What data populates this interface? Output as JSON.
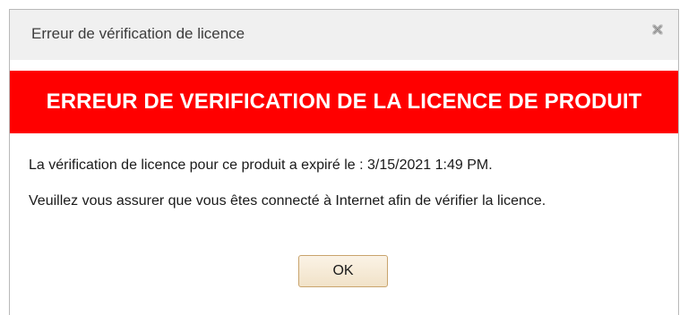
{
  "window": {
    "title": "Erreur de vérification de licence",
    "close_icon": "close-icon"
  },
  "banner": {
    "text": "ERREUR DE VERIFICATION DE LA LICENCE DE PRODUIT",
    "color": "#ff0000"
  },
  "message": {
    "line1": "La vérification de licence pour ce produit a expiré le : 3/15/2021 1:49 PM.",
    "line2": "Veuillez vous assurer que vous êtes connecté à Internet afin de vérifier la licence."
  },
  "buttons": {
    "ok_label": "OK"
  }
}
